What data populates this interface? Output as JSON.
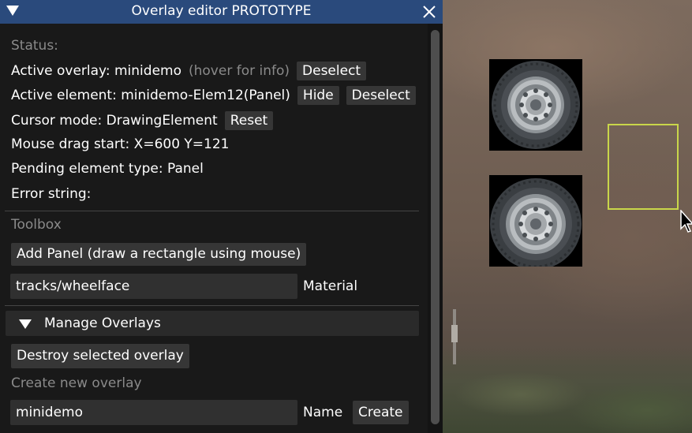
{
  "window": {
    "title": "Overlay editor PROTOTYPE"
  },
  "status": {
    "heading": "Status:",
    "active_overlay_label": "Active overlay: minidemo",
    "hover_hint": "(hover for info)",
    "deselect_label": "Deselect",
    "active_element_label": "Active element: minidemo-Elem12(Panel)",
    "hide_label": "Hide",
    "deselect_element_label": "Deselect",
    "cursor_mode": "Cursor mode: DrawingElement",
    "reset_label": "Reset",
    "mouse_drag_start": "Mouse drag start: X=600 Y=121",
    "pending_type": "Pending element type: Panel",
    "error_string": "Error string:"
  },
  "toolbox": {
    "heading": "Toolbox",
    "add_panel_label": "Add Panel (draw a rectangle using mouse)",
    "material_value": "tracks/wheelface",
    "material_label": "Material"
  },
  "manage": {
    "header_label": "Manage Overlays",
    "destroy_label": "Destroy selected overlay",
    "create_heading": "Create new overlay",
    "name_value": "minidemo",
    "name_label": "Name",
    "create_label": "Create"
  },
  "colors": {
    "titlebar": "#2a4a7c",
    "window_bg": "#191919",
    "button_bg": "#363636",
    "input_bg": "#303030",
    "selection_rect": "#c9d64a"
  },
  "icons": {
    "collapse": "triangle-down-icon",
    "close": "close-icon",
    "cursor": "mouse-pointer-icon"
  }
}
